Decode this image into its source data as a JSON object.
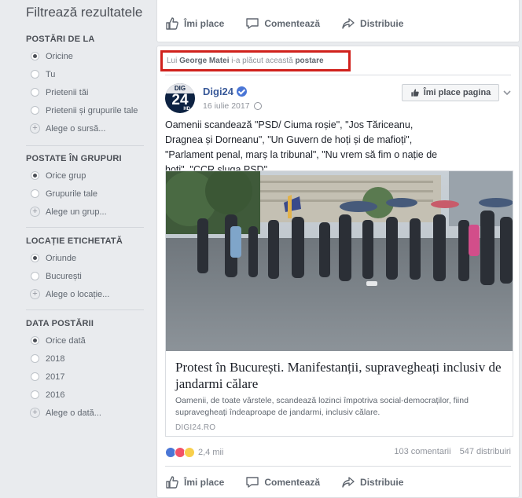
{
  "sidebar": {
    "title": "Filtrează rezultatele",
    "groups": [
      {
        "heading": "POSTĂRI DE LA",
        "options": [
          "Oricine",
          "Tu",
          "Prietenii tăi",
          "Prietenii și grupurile tale"
        ],
        "selected": 0,
        "add_label": "Alege o sursă..."
      },
      {
        "heading": "POSTATE ÎN GRUPURI",
        "options": [
          "Orice grup",
          "Grupurile tale"
        ],
        "selected": 0,
        "add_label": "Alege un grup..."
      },
      {
        "heading": "LOCAȚIE ETICHETATĂ",
        "options": [
          "Oriunde",
          "București"
        ],
        "selected": 0,
        "add_label": "Alege o locație..."
      },
      {
        "heading": "DATA POSTĂRII",
        "options": [
          "Orice dată",
          "2018",
          "2017",
          "2016"
        ],
        "selected": 0,
        "add_label": "Alege o dată..."
      }
    ]
  },
  "top_card": {
    "actions": {
      "like": "Îmi place",
      "comment": "Comentează",
      "share": "Distribuie"
    }
  },
  "story": {
    "liked_prefix": "Lui",
    "liked_person": "George Matei",
    "liked_middle": "i-a plăcut această",
    "liked_object": "postare",
    "page": {
      "name": "Digi24",
      "date": "16 iulie 2017",
      "avatar_top": "DIG",
      "avatar_mid": "24",
      "avatar_hd": "HD",
      "like_page_label": "Îmi place pagina"
    },
    "text": "Oamenii scandează \"PSD/ Ciuma roșie\", \"Jos Tăriceanu, Dragnea și Dorneanu\", \"Un Guvern de hoți și de mafioți\", \"Parlament penal, marș la tribunal\", \"Nu vrem să fim o nație de hoți\", \"CCR sluga PSD\".",
    "link": {
      "title": "Protest în București. Manifestanții, supravegheați inclusiv de jandarmi călare",
      "description": "Oamenii, de toate vârstele, scandează lozinci împotriva social-democraților, fiind supravegheați îndeaproape de jandarmi, inclusiv călare.",
      "domain": "DIGI24.RO"
    },
    "reactions_count": "2,4 mii",
    "comments": "103 comentarii",
    "shares": "547 distribuiri",
    "actions": {
      "like": "Îmi place",
      "comment": "Comentează",
      "share": "Distribuie"
    }
  },
  "colors": {
    "link_blue": "#385898",
    "highlight_red": "#d0211c",
    "background": "#e9ebee"
  }
}
